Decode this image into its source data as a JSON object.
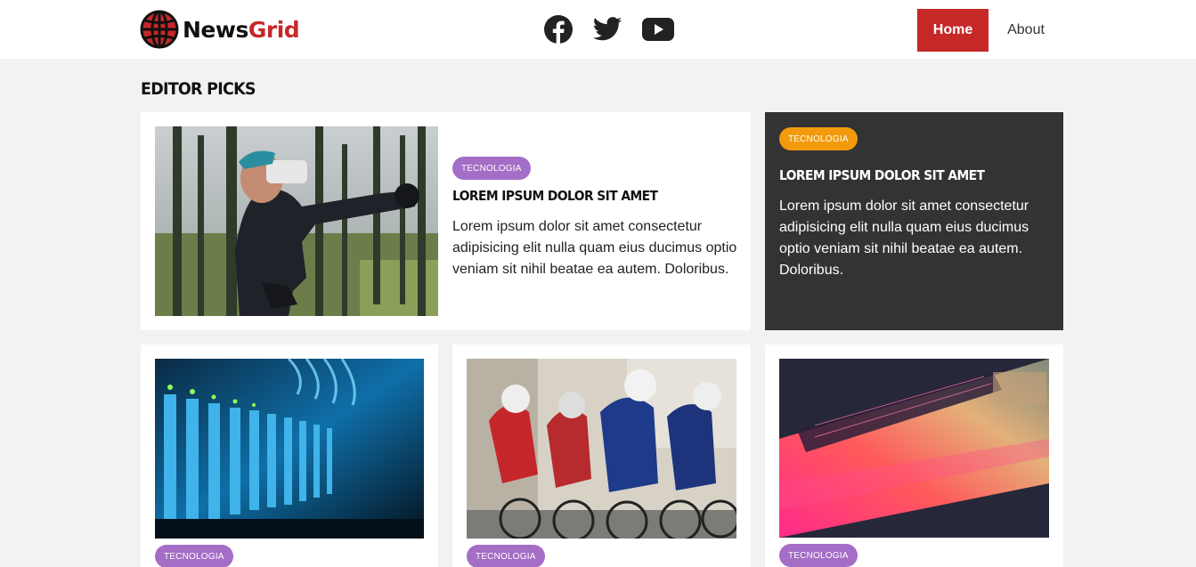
{
  "header": {
    "logo": {
      "part1": "News",
      "part2": "Grid",
      "icon": "globe-icon",
      "colors": {
        "dark": "#111111",
        "accent": "#c62828"
      }
    },
    "social": [
      {
        "name": "facebook-icon"
      },
      {
        "name": "twitter-icon"
      },
      {
        "name": "youtube-icon"
      }
    ],
    "nav": {
      "home": "Home",
      "about": "About"
    }
  },
  "section": {
    "title": "EDITOR PICKS"
  },
  "featured": {
    "tag": "TECNOLOGIA",
    "title": "LOREM IPSUM DOLOR SIT AMET",
    "text": "Lorem ipsum dolor sit amet consectetur adipisicing elit nulla quam eius ducimus optio veniam sit nihil beatae ea autem. Doloribus.",
    "image": "vr-headset-man-forest-photo"
  },
  "side": {
    "tag": "TECNOLOGIA",
    "title": "LOREM IPSUM DOLOR SIT AMET",
    "text": "Lorem ipsum dolor sit amet consectetur adipisicing elit nulla quam eius ducimus optio veniam sit nihil beatae ea autem. Doloribus."
  },
  "grid": [
    {
      "tag": "TECNOLOGIA",
      "image": "server-rack-photo"
    },
    {
      "tag": "TECNOLOGIA",
      "image": "cyclists-race-photo"
    },
    {
      "tag": "TECNOLOGIA",
      "image": "laptop-keyboard-photo"
    }
  ],
  "colors": {
    "brand_red": "#c62828",
    "tag_purple": "#a46dc6",
    "tag_orange": "#f39a0c",
    "dark_card": "#333333",
    "page_bg": "#f2f2f2"
  }
}
